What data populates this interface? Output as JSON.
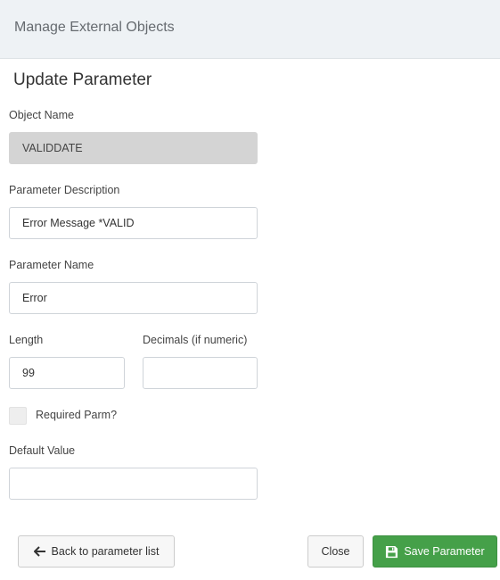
{
  "header": {
    "title": "Manage External Objects"
  },
  "form": {
    "title": "Update Parameter",
    "object_name": {
      "label": "Object Name",
      "value": "VALIDDATE"
    },
    "parameter_description": {
      "label": "Parameter Description",
      "value": "Error Message *VALID"
    },
    "parameter_name": {
      "label": "Parameter Name",
      "value": "Error"
    },
    "length": {
      "label": "Length",
      "value": "99"
    },
    "decimals": {
      "label": "Decimals (if numeric)",
      "value": ""
    },
    "required": {
      "label": "Required Parm?",
      "checked": false
    },
    "default_value": {
      "label": "Default Value",
      "value": ""
    }
  },
  "actions": {
    "back_label": "Back to parameter list",
    "back_icon": "arrow-left-icon",
    "close_label": "Close",
    "save_label": "Save Parameter",
    "save_icon": "floppy-disk-icon",
    "save_color": "#45a049"
  }
}
